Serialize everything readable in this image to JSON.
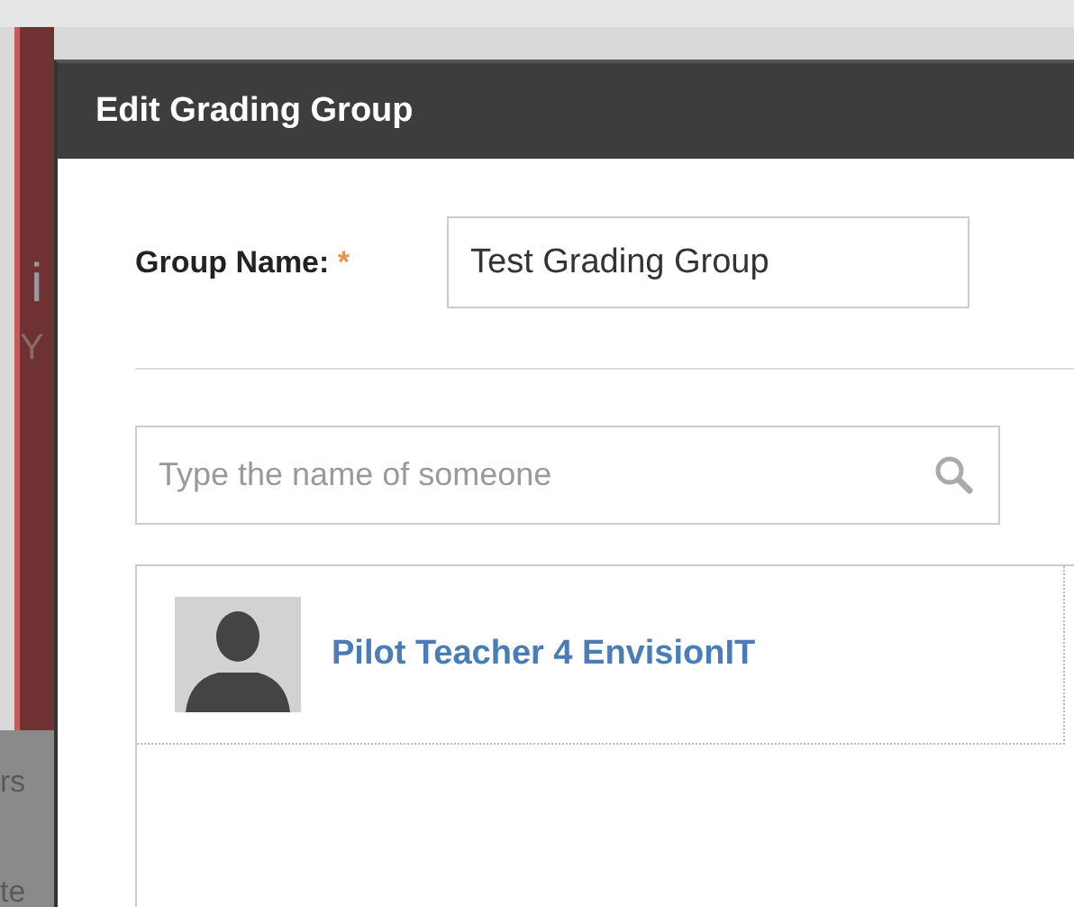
{
  "background": {
    "fragments": [
      {
        "text": "i",
        "kind": "heading"
      },
      {
        "text": "Y",
        "kind": "subtitle"
      },
      {
        "text": "rs",
        "kind": "menu"
      },
      {
        "text": "te",
        "kind": "menu"
      }
    ]
  },
  "dialog": {
    "title": "Edit Grading Group",
    "group_name": {
      "label": "Group Name:",
      "required_mark": "*",
      "value": "Test Grading Group"
    },
    "search": {
      "placeholder": "Type the name of someone"
    },
    "members": [
      {
        "name": "Pilot Teacher 4 EnvisionIT"
      }
    ]
  }
}
